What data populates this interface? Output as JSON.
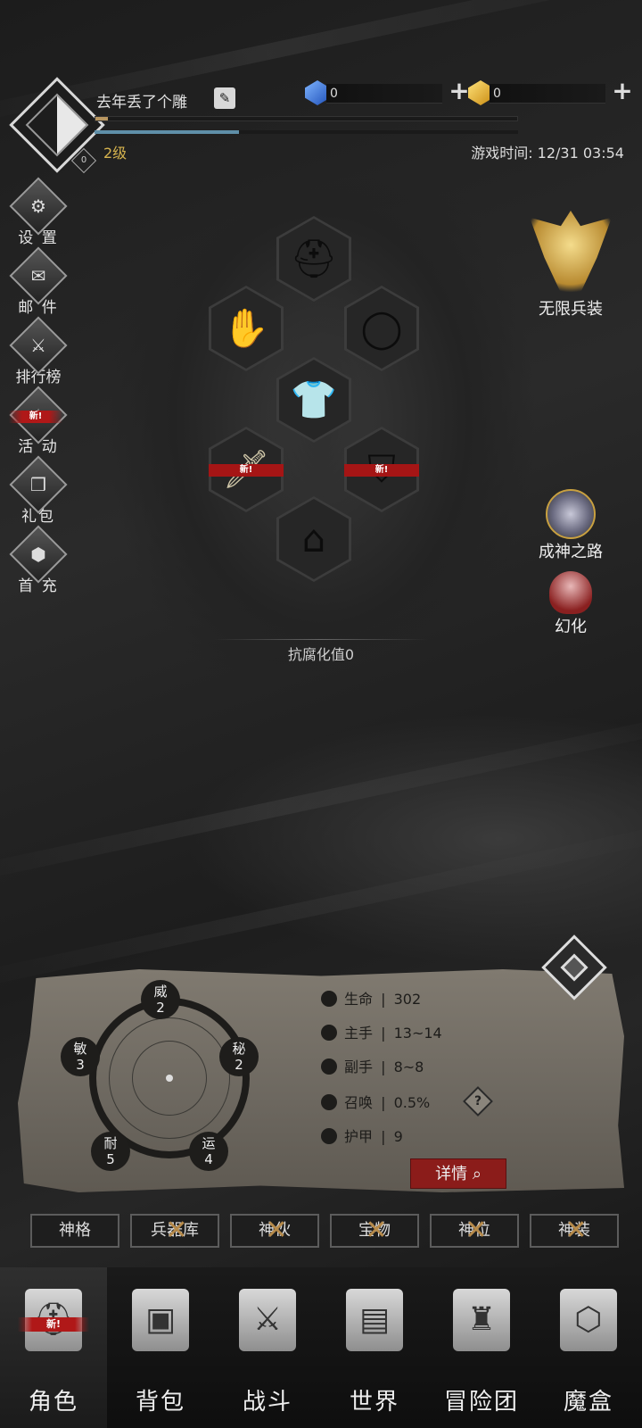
{
  "header": {
    "player_name": "去年丢了个雕",
    "edit_icon": "edit-icon",
    "level_badge": "0",
    "level_text": "2级",
    "game_time_label": "游戏时间: 12/31 03:54",
    "xp_progress": 0.03,
    "secondary_progress": 0.34,
    "currencies": [
      {
        "icon": "blue-gem-icon",
        "amount": "0",
        "color": "#3d7ee0"
      },
      {
        "icon": "gold-gem-icon",
        "amount": "0",
        "color": "#e0a020"
      }
    ]
  },
  "left_menu": [
    {
      "label": "设 置",
      "icon": "gear-icon",
      "new": false
    },
    {
      "label": "邮 件",
      "icon": "mail-icon",
      "new": false
    },
    {
      "label": "排行榜",
      "icon": "ranking-icon",
      "new": false
    },
    {
      "label": "活 动",
      "icon": "event-icon",
      "new": true
    },
    {
      "label": "礼包",
      "icon": "gift-icon",
      "new": false
    },
    {
      "label": "首 充",
      "icon": "first-charge-icon",
      "new": false
    }
  ],
  "new_tag": "新!",
  "right_features": {
    "infinite": "无限兵装",
    "godpath": "成神之路",
    "illusion": "幻化"
  },
  "equipment": {
    "resist_label": "抗腐化值0"
  },
  "attributes": {
    "wei": {
      "name": "威",
      "value": "2"
    },
    "mi": {
      "name": "秘",
      "value": "2"
    },
    "yun": {
      "name": "运",
      "value": "4"
    },
    "nai": {
      "name": "耐",
      "value": "5"
    },
    "min": {
      "name": "敏",
      "value": "3"
    }
  },
  "stats": [
    {
      "icon": "heart-icon",
      "name": "生命",
      "value": "302"
    },
    {
      "icon": "main-hand-icon",
      "name": "主手",
      "value": "13~14"
    },
    {
      "icon": "off-hand-icon",
      "name": "副手",
      "value": "8~8"
    },
    {
      "icon": "summon-icon",
      "name": "召唤",
      "value": "0.5%"
    },
    {
      "icon": "armor-icon",
      "name": "护甲",
      "value": "9"
    }
  ],
  "stat_sep": "|",
  "help_mark": "?",
  "detail_button": "详情",
  "sub_tabs": [
    {
      "label": "神格",
      "locked": false
    },
    {
      "label": "兵器库",
      "locked": true
    },
    {
      "label": "神伙",
      "locked": true
    },
    {
      "label": "宝物",
      "locked": true
    },
    {
      "label": "神位",
      "locked": true
    },
    {
      "label": "神装",
      "locked": true
    }
  ],
  "bottom_nav": [
    {
      "label": "角色",
      "icon": "helmet-icon",
      "new": true
    },
    {
      "label": "背包",
      "icon": "backpack-icon",
      "new": false
    },
    {
      "label": "战斗",
      "icon": "sword-shield-icon",
      "new": false
    },
    {
      "label": "世界",
      "icon": "map-scroll-icon",
      "new": false
    },
    {
      "label": "冒险团",
      "icon": "castle-icon",
      "new": false
    },
    {
      "label": "魔盒",
      "icon": "magic-box-icon",
      "new": false
    }
  ]
}
